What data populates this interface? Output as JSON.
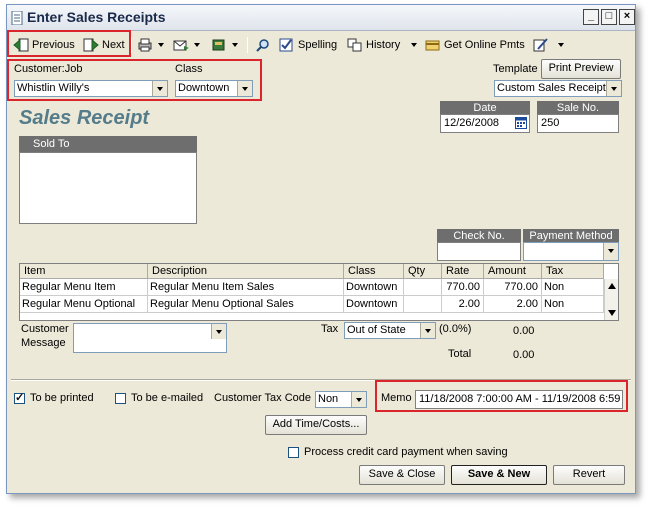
{
  "window": {
    "title": "Enter Sales Receipts",
    "controls": {
      "minimize": "_",
      "maximize": "□",
      "close": "×"
    }
  },
  "toolbar": {
    "previous": "Previous",
    "next": "Next",
    "spelling": "Spelling",
    "history": "History",
    "get_online_pmts": "Get Online Pmts"
  },
  "header": {
    "customer_job_label": "Customer:Job",
    "customer_job_value": "Whistlin Willy's",
    "class_label": "Class",
    "class_value": "Downtown",
    "template_label": "Template",
    "print_preview": "Print Preview",
    "template_value": "Custom Sales Receipt"
  },
  "form": {
    "title": "Sales Receipt",
    "date_label": "Date",
    "date_value": "12/26/2008",
    "sale_no_label": "Sale No.",
    "sale_no_value": "250",
    "sold_to_label": "Sold To",
    "sold_to_value": "",
    "check_no_label": "Check No.",
    "check_no_value": "",
    "payment_method_label": "Payment Method",
    "payment_method_value": ""
  },
  "items": {
    "columns": [
      "Item",
      "Description",
      "Class",
      "Qty",
      "Rate",
      "Amount",
      "Tax"
    ],
    "rows": [
      {
        "item": "Regular Menu Item",
        "description": "Regular Menu Item Sales",
        "class": "Downtown",
        "qty": "",
        "rate": "770.00",
        "amount": "770.00",
        "tax": "Non"
      },
      {
        "item": "Regular Menu Optional",
        "description": "Regular Menu Optional Sales",
        "class": "Downtown",
        "qty": "",
        "rate": "2.00",
        "amount": "2.00",
        "tax": "Non"
      }
    ]
  },
  "footer": {
    "customer_message_label_1": "Customer",
    "customer_message_label_2": "Message",
    "customer_message_value": "",
    "tax_label": "Tax",
    "tax_value": "Out of State",
    "tax_rate": "(0.0%)",
    "tax_amount": "0.00",
    "total_label": "Total",
    "total_amount": "0.00",
    "to_be_printed": "To be printed",
    "to_be_printed_checked": true,
    "to_be_emailed": "To be e-mailed",
    "to_be_emailed_checked": false,
    "customer_tax_code_label": "Customer Tax Code",
    "customer_tax_code_value": "Non",
    "memo_label": "Memo",
    "memo_value": "11/18/2008 7:00:00 AM - 11/19/2008 6:59",
    "add_time_costs": "Add Time/Costs...",
    "process_cc_label": "Process credit card payment when saving",
    "process_cc_checked": false,
    "save_close": "Save & Close",
    "save_new": "Save & New",
    "revert": "Revert"
  },
  "colors": {
    "highlight_box": "#d9252b",
    "window_bg": "#ece9d8",
    "title_teal": "#557c8a",
    "header_gray": "#6e6e6e"
  }
}
